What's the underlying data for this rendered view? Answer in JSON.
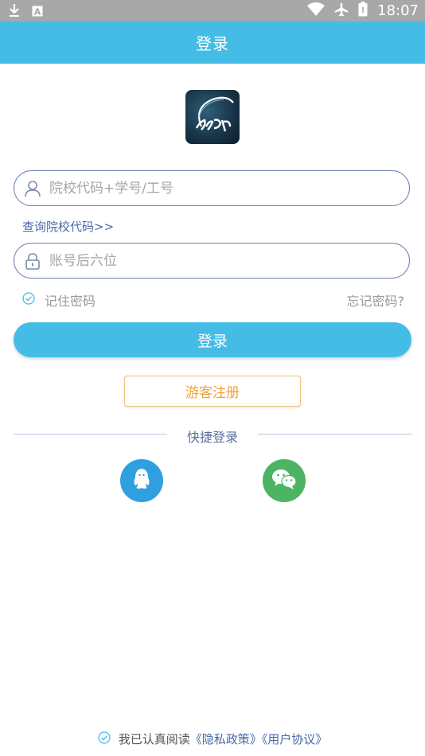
{
  "status_bar": {
    "time": "18:07",
    "icons": [
      "download-icon",
      "a-notification-icon",
      "wifi-icon",
      "airplane-icon",
      "battery-icon"
    ]
  },
  "header": {
    "title": "登录"
  },
  "form": {
    "school_field": {
      "placeholder": "院校代码+学号/工号",
      "value": ""
    },
    "query_link": "查询院校代码>>",
    "password_field": {
      "placeholder": "账号后六位",
      "value": ""
    },
    "remember_label": "记住密码",
    "forgot_label": "忘记密码?",
    "login_button": "登录",
    "guest_button": "游客注册"
  },
  "quick_login": {
    "label": "快捷登录",
    "options": [
      "qq-icon",
      "wechat-icon"
    ]
  },
  "agreement": {
    "text": "我已认真阅读",
    "privacy_link": "《隐私政策》",
    "terms_link": "《用户协议》"
  },
  "colors": {
    "primary": "#45bce6",
    "field_border": "#6c7fae",
    "link": "#4a6aa6",
    "guest": "#f0a235",
    "qq": "#2f9fe0",
    "wechat": "#4cb463",
    "status_bar": "#a8a8a8"
  }
}
